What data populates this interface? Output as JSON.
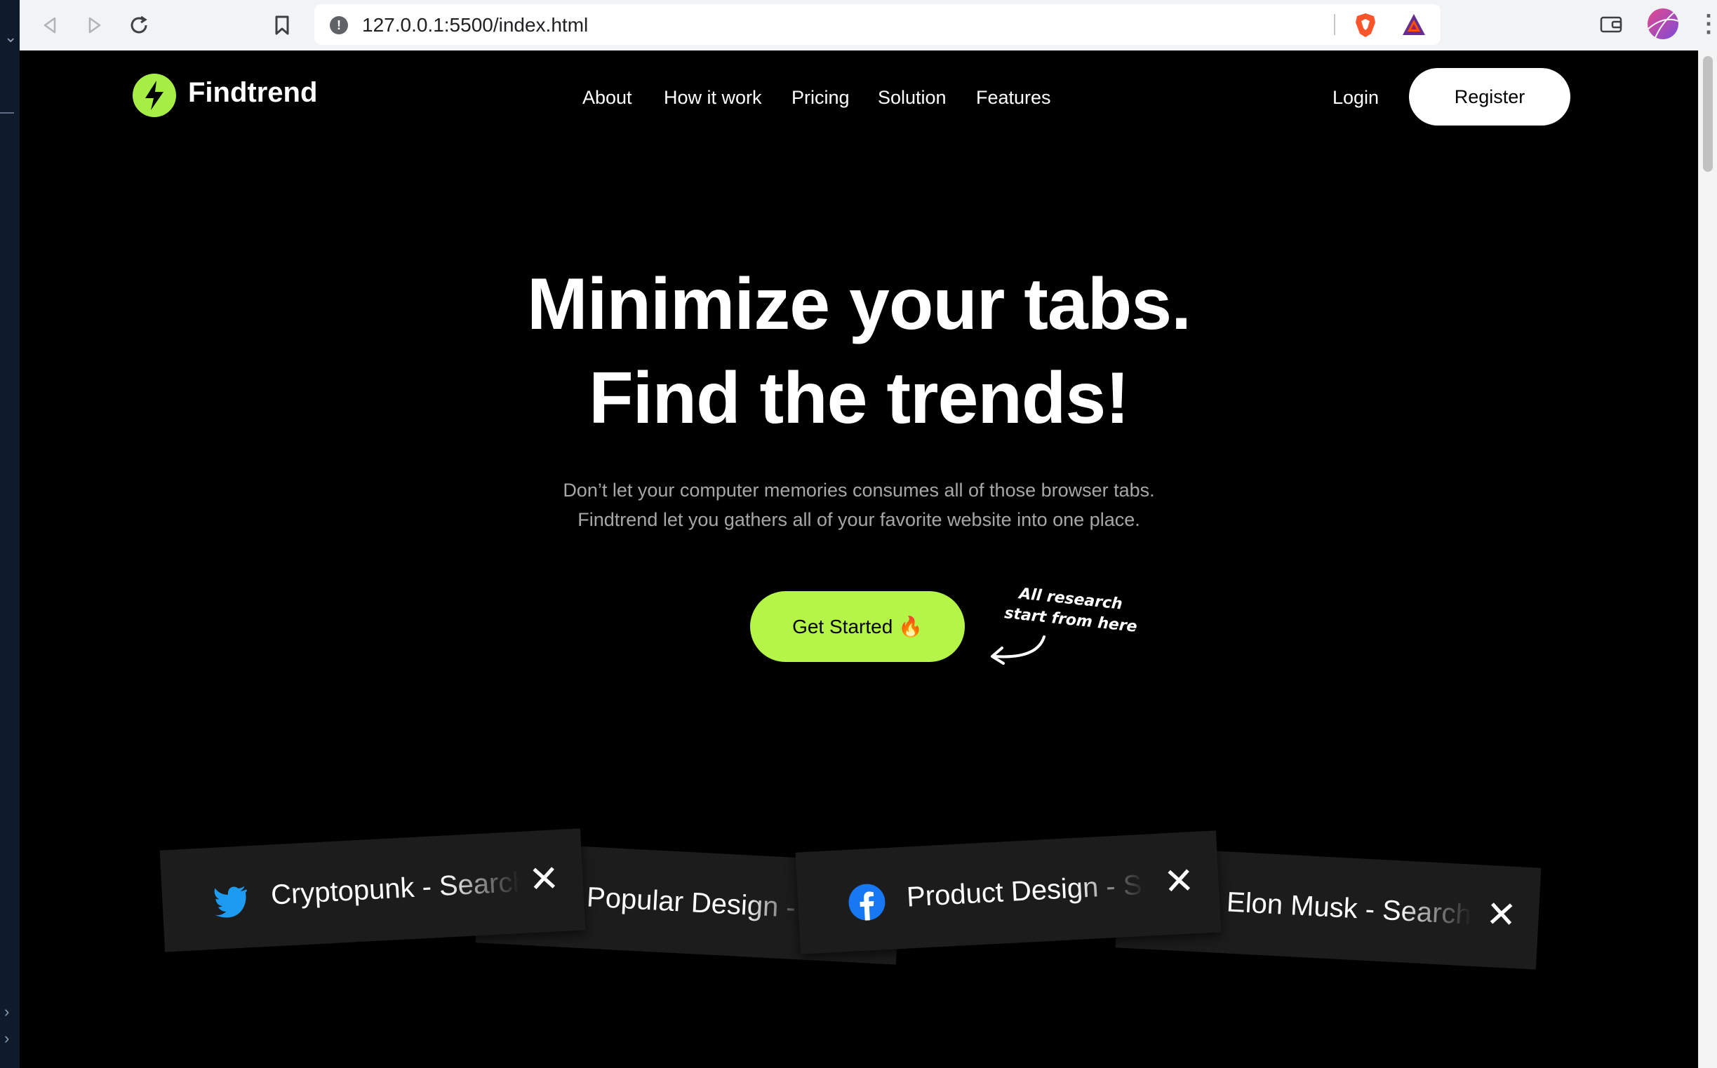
{
  "browser": {
    "url": "127.0.0.1:5500/index.html"
  },
  "site": {
    "brand": "Findtrend",
    "nav": [
      "About",
      "How it work",
      "Pricing",
      "Solution",
      "Features"
    ],
    "login_label": "Login",
    "register_label": "Register"
  },
  "hero": {
    "title_line1": "Minimize your tabs.",
    "title_line2": "Find the trends!",
    "subtitle_line1": "Don’t let your computer memories consumes all of those browser tabs.",
    "subtitle_line2": "Findtrend let you gathers all of your favorite website into one place.",
    "cta_label": "Get Started 🔥",
    "note_line1": "All research",
    "note_line2": "start from here"
  },
  "tabs": [
    {
      "label": "Cryptopunk - Search",
      "icon": "twitter-icon"
    },
    {
      "label": "Popular Design - Search",
      "icon": "pinterest-icon"
    },
    {
      "label": "Product Design - Search",
      "icon": "facebook-icon"
    },
    {
      "label": "Elon Musk - Search",
      "icon": "dribbble-icon"
    }
  ],
  "colors": {
    "accent": "#b5f548",
    "background": "#000000"
  }
}
